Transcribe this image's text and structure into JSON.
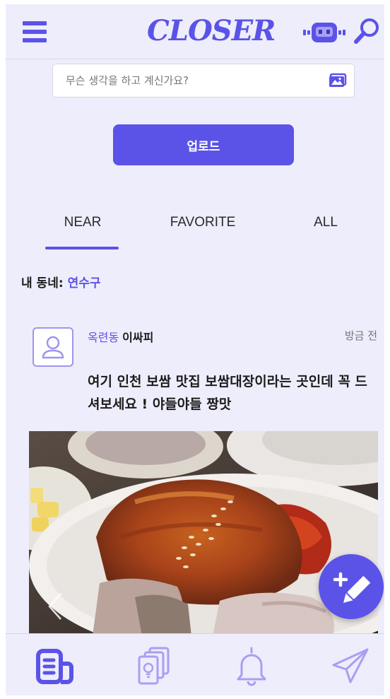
{
  "header": {
    "logo_text": "CLOSER",
    "menu_icon": "hamburger-menu-icon",
    "robot_icon": "robot-icon",
    "search_icon": "search-icon"
  },
  "composer": {
    "placeholder": "무슨 생각을 하고 계신가요?",
    "image_icon": "image-icon",
    "upload_label": "업로드"
  },
  "tabs": [
    {
      "label": "NEAR",
      "active": true
    },
    {
      "label": "FAVORITE",
      "active": false
    },
    {
      "label": "ALL",
      "active": false
    }
  ],
  "region": {
    "prefix": "내 동네: ",
    "name": "연수구"
  },
  "post": {
    "dong": "옥련동",
    "nickname": "이싸피",
    "time": "방금 전",
    "text": "여기 인천 보쌈 맛집 보쌈대장이라는 곳인데 꼭 드셔보세요 ! 야들야들 짱맛"
  },
  "bottom_nav": [
    {
      "icon": "feed-icon",
      "active": true
    },
    {
      "icon": "cards-icon",
      "active": false
    },
    {
      "icon": "bell-icon",
      "active": false
    },
    {
      "icon": "send-icon",
      "active": false
    }
  ],
  "colors": {
    "accent": "#5b53e8",
    "accent_light": "#a79ff3",
    "background": "#eeedfb"
  }
}
